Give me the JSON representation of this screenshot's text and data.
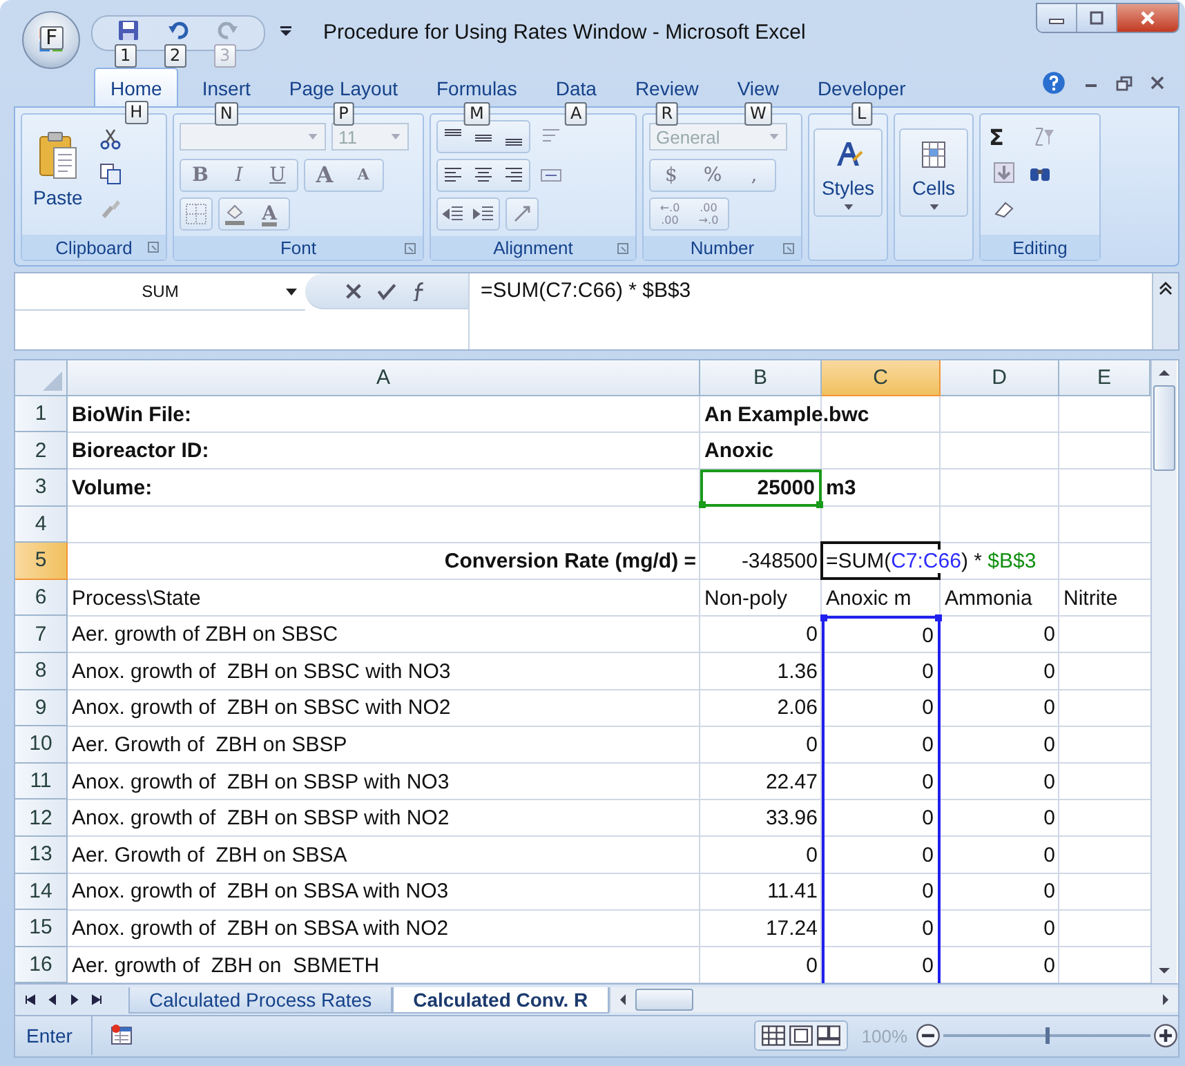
{
  "window": {
    "title": "Procedure for Using Rates Window - Microsoft Excel"
  },
  "office_button": {
    "keytip": "F"
  },
  "quick_access": [
    {
      "kind": "save",
      "keytip": "1",
      "disabled": false
    },
    {
      "kind": "undo",
      "keytip": "2",
      "disabled": false
    },
    {
      "kind": "redo",
      "keytip": "3",
      "disabled": true
    }
  ],
  "tabs": [
    {
      "label": "Home",
      "keytip": "H",
      "selected": true
    },
    {
      "label": "Insert",
      "keytip": "N",
      "selected": false
    },
    {
      "label": "Page Layout",
      "keytip": "P",
      "selected": false
    },
    {
      "label": "Formulas",
      "keytip": "M",
      "selected": false
    },
    {
      "label": "Data",
      "keytip": "A",
      "selected": false
    },
    {
      "label": "Review",
      "keytip": "R",
      "selected": false
    },
    {
      "label": "View",
      "keytip": "W",
      "selected": false
    },
    {
      "label": "Developer",
      "keytip": "L",
      "selected": false
    }
  ],
  "ribbon": {
    "clipboard": {
      "label": "Clipboard",
      "paste": "Paste"
    },
    "font": {
      "label": "Font",
      "size": "11",
      "bold": "B",
      "italic": "I",
      "underline": "U",
      "grow": "A",
      "shrink": "A",
      "text_tint": "A"
    },
    "alignment": {
      "label": "Alignment"
    },
    "number": {
      "label": "Number",
      "format": "General",
      "currency": "$",
      "percent": "%",
      "comma": ",",
      "increase_decimal": [
        "←.0",
        ".00"
      ],
      "decrease_decimal": [
        ".00",
        "→.0"
      ]
    },
    "styles": {
      "label": "Styles"
    },
    "cells": {
      "label": "Cells"
    },
    "editing": {
      "label": "Editing",
      "sum": "Σ"
    }
  },
  "formula_bar": {
    "name_box": "SUM",
    "formula": "=SUM(C7:C66) * $B$3"
  },
  "sheet": {
    "columns": [
      {
        "label": "A",
        "selected": false
      },
      {
        "label": "B",
        "selected": false
      },
      {
        "label": "C",
        "selected": true
      },
      {
        "label": "D",
        "selected": false
      },
      {
        "label": "E",
        "selected": false
      }
    ],
    "rows": [
      {
        "num": "1",
        "selected": false,
        "cells": [
          {
            "kind": "label",
            "text": "BioWin File:",
            "bold": true
          },
          {
            "kind": "label",
            "text": "An Example.bwc",
            "bold": true
          },
          null,
          null,
          null
        ]
      },
      {
        "num": "2",
        "selected": false,
        "cells": [
          {
            "kind": "label",
            "text": "Bioreactor ID:",
            "bold": true
          },
          {
            "kind": "label",
            "text": "Anoxic",
            "bold": true
          },
          null,
          null,
          null
        ]
      },
      {
        "num": "3",
        "selected": false,
        "cells": [
          {
            "kind": "label",
            "text": "Volume:",
            "bold": true
          },
          {
            "kind": "number",
            "text": "25000",
            "bold": true,
            "referenced": true
          },
          {
            "kind": "label",
            "text": "m3",
            "bold": true
          },
          null,
          null
        ]
      },
      {
        "num": "4",
        "selected": false,
        "cells": [
          null,
          null,
          null,
          null,
          null
        ]
      },
      {
        "num": "5",
        "selected": true,
        "cells": [
          {
            "kind": "caption",
            "text": "Conversion Rate (mg/d) =",
            "bold": true
          },
          {
            "kind": "number",
            "text": "-348500",
            "bold": false
          },
          {
            "kind": "formula",
            "active": true,
            "parts": [
              {
                "kind": "plain",
                "text": "=SUM("
              },
              {
                "kind": "range",
                "text": "C7:C66"
              },
              {
                "kind": "plain",
                "text": ") * "
              },
              {
                "kind": "reference",
                "text": "$B$3"
              }
            ]
          },
          null,
          null
        ]
      },
      {
        "num": "6",
        "selected": false,
        "cells": [
          {
            "kind": "label",
            "text": "Process\\State",
            "bold": false
          },
          {
            "kind": "label",
            "text": "Non-poly",
            "bold": false
          },
          {
            "kind": "label",
            "text": "Anoxic m",
            "bold": false
          },
          {
            "kind": "label",
            "text": "Ammonia",
            "bold": false
          },
          {
            "kind": "label",
            "text": "Nitrite",
            "bold": false
          }
        ]
      },
      {
        "num": "7",
        "selected": false,
        "cells": [
          {
            "kind": "label",
            "text": "Aer. growth of ZBH on SBSC",
            "bold": false
          },
          {
            "kind": "number",
            "text": "0",
            "bold": false
          },
          {
            "kind": "number",
            "text": "0",
            "bold": false,
            "in_range": true,
            "range_top": true
          },
          {
            "kind": "number",
            "text": "0",
            "bold": false
          },
          null
        ]
      },
      {
        "num": "8",
        "selected": false,
        "cells": [
          {
            "kind": "label",
            "text": "Anox. growth of  ZBH on SBSC with NO3",
            "bold": false
          },
          {
            "kind": "number",
            "text": "1.36",
            "bold": false
          },
          {
            "kind": "number",
            "text": "0",
            "bold": false,
            "in_range": true
          },
          {
            "kind": "number",
            "text": "0",
            "bold": false
          },
          null
        ]
      },
      {
        "num": "9",
        "selected": false,
        "cells": [
          {
            "kind": "label",
            "text": "Anox. growth of  ZBH on SBSC with NO2",
            "bold": false
          },
          {
            "kind": "number",
            "text": "2.06",
            "bold": false
          },
          {
            "kind": "number",
            "text": "0",
            "bold": false,
            "in_range": true
          },
          {
            "kind": "number",
            "text": "0",
            "bold": false
          },
          null
        ]
      },
      {
        "num": "10",
        "selected": false,
        "cells": [
          {
            "kind": "label",
            "text": "Aer. Growth of  ZBH on SBSP",
            "bold": false
          },
          {
            "kind": "number",
            "text": "0",
            "bold": false
          },
          {
            "kind": "number",
            "text": "0",
            "bold": false,
            "in_range": true
          },
          {
            "kind": "number",
            "text": "0",
            "bold": false
          },
          null
        ]
      },
      {
        "num": "11",
        "selected": false,
        "cells": [
          {
            "kind": "label",
            "text": "Anox. growth of  ZBH on SBSP with NO3",
            "bold": false
          },
          {
            "kind": "number",
            "text": "22.47",
            "bold": false
          },
          {
            "kind": "number",
            "text": "0",
            "bold": false,
            "in_range": true
          },
          {
            "kind": "number",
            "text": "0",
            "bold": false
          },
          null
        ]
      },
      {
        "num": "12",
        "selected": false,
        "cells": [
          {
            "kind": "label",
            "text": "Anox. growth of  ZBH on SBSP with NO2",
            "bold": false
          },
          {
            "kind": "number",
            "text": "33.96",
            "bold": false
          },
          {
            "kind": "number",
            "text": "0",
            "bold": false,
            "in_range": true
          },
          {
            "kind": "number",
            "text": "0",
            "bold": false
          },
          null
        ]
      },
      {
        "num": "13",
        "selected": false,
        "cells": [
          {
            "kind": "label",
            "text": "Aer. Growth of  ZBH on SBSA",
            "bold": false
          },
          {
            "kind": "number",
            "text": "0",
            "bold": false
          },
          {
            "kind": "number",
            "text": "0",
            "bold": false,
            "in_range": true
          },
          {
            "kind": "number",
            "text": "0",
            "bold": false
          },
          null
        ]
      },
      {
        "num": "14",
        "selected": false,
        "cells": [
          {
            "kind": "label",
            "text": "Anox. growth of  ZBH on SBSA with NO3",
            "bold": false
          },
          {
            "kind": "number",
            "text": "11.41",
            "bold": false
          },
          {
            "kind": "number",
            "text": "0",
            "bold": false,
            "in_range": true
          },
          {
            "kind": "number",
            "text": "0",
            "bold": false
          },
          null
        ]
      },
      {
        "num": "15",
        "selected": false,
        "cells": [
          {
            "kind": "label",
            "text": "Anox. growth of  ZBH on SBSA with NO2",
            "bold": false
          },
          {
            "kind": "number",
            "text": "17.24",
            "bold": false
          },
          {
            "kind": "number",
            "text": "0",
            "bold": false,
            "in_range": true
          },
          {
            "kind": "number",
            "text": "0",
            "bold": false
          },
          null
        ]
      },
      {
        "num": "16",
        "selected": false,
        "cells": [
          {
            "kind": "label",
            "text": "Aer. growth of  ZBH on  SBMETH",
            "bold": false
          },
          {
            "kind": "number",
            "text": "0",
            "bold": false
          },
          {
            "kind": "number",
            "text": "0",
            "bold": false,
            "in_range": true
          },
          {
            "kind": "number",
            "text": "0",
            "bold": false
          },
          null
        ]
      }
    ]
  },
  "sheet_tabs": [
    {
      "label": "Calculated Process Rates",
      "selected": false
    },
    {
      "label": "Calculated Conv. R",
      "selected": true
    }
  ],
  "status_bar": {
    "mode": "Enter",
    "zoom": "100%",
    "zoom_slider": {
      "level": 0.5
    }
  }
}
